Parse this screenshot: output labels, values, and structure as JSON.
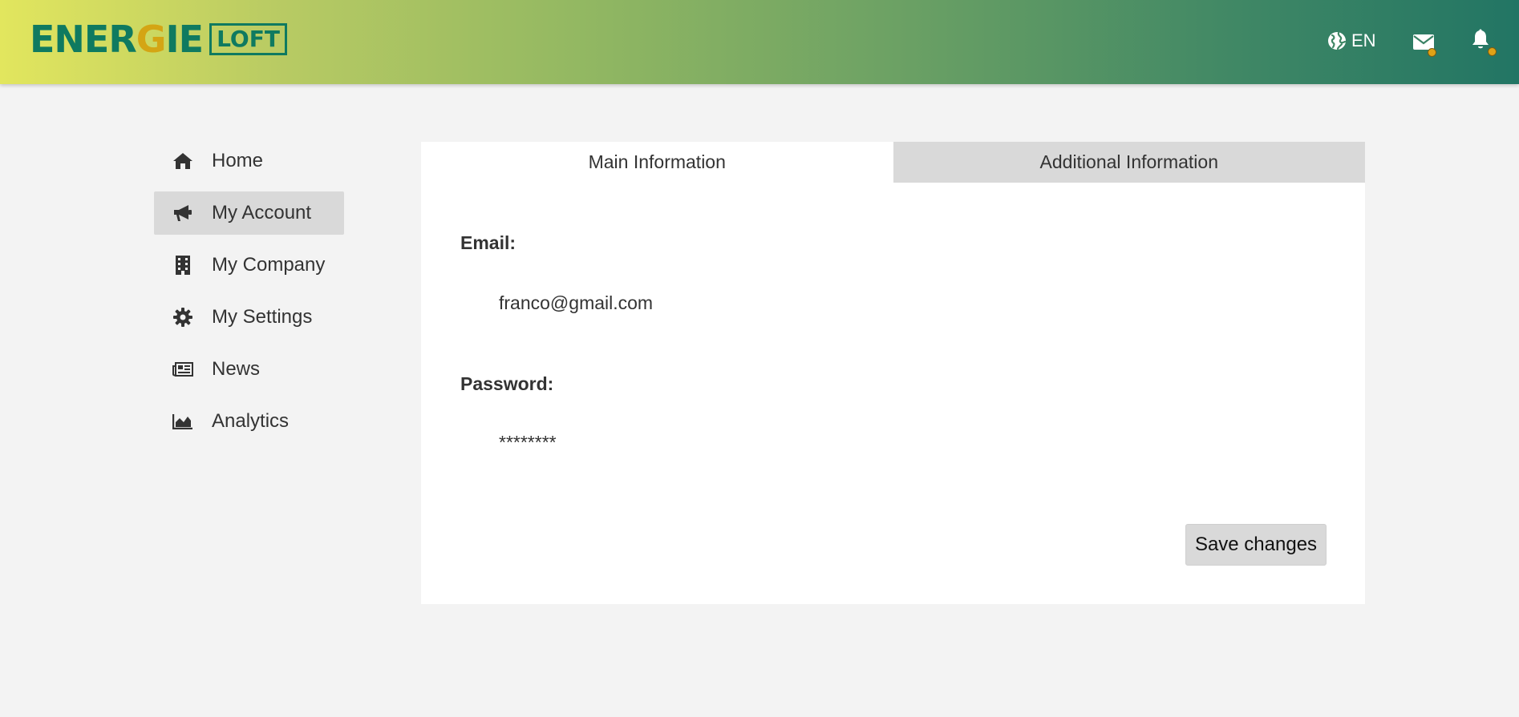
{
  "header": {
    "logo": {
      "word_part1": "ENER",
      "word_accent": "G",
      "word_part2": "IE",
      "box_text": "LOFT"
    },
    "language": "EN",
    "icons": {
      "language": "globe-icon",
      "messages": "envelope-icon",
      "notifications": "bell-icon"
    },
    "colors": {
      "gradient_start": "#e2e65e",
      "gradient_end": "#227564",
      "badge": "#e0a216"
    }
  },
  "sidebar": {
    "items": [
      {
        "label": "Home",
        "icon": "home-icon",
        "active": false
      },
      {
        "label": "My Account",
        "icon": "megaphone-icon",
        "active": true
      },
      {
        "label": "My Company",
        "icon": "building-icon",
        "active": false
      },
      {
        "label": "My Settings",
        "icon": "gear-icon",
        "active": false
      },
      {
        "label": "News",
        "icon": "newspaper-icon",
        "active": false
      },
      {
        "label": "Analytics",
        "icon": "area-chart-icon",
        "active": false
      }
    ]
  },
  "main": {
    "tabs": [
      {
        "label": "Main Information",
        "active": true
      },
      {
        "label": "Additional Information",
        "active": false
      }
    ],
    "fields": {
      "email_label": "Email:",
      "email_value": "franco@gmail.com",
      "password_label": "Password:",
      "password_value": "********"
    },
    "save_label": "Save changes"
  }
}
